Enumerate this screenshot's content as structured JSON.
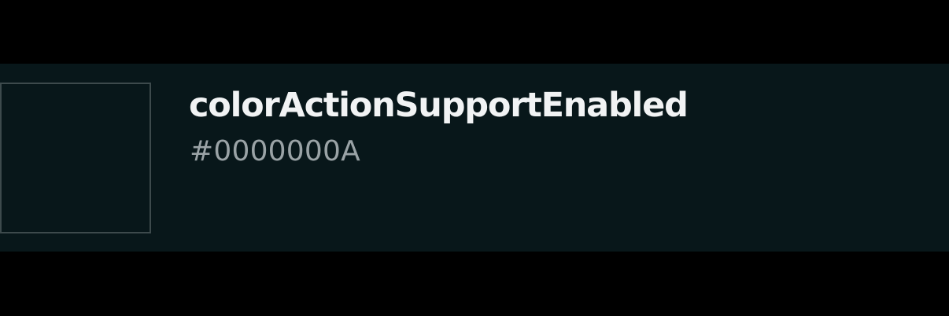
{
  "colors": {
    "background": "#000000",
    "row_background": "#08171a",
    "swatch_border": "#3d4a4c",
    "name_color": "#f1f3f4",
    "value_color": "#9aa3a6"
  },
  "token": {
    "name": "colorActionSupportEnabled",
    "value": "#0000000A"
  }
}
